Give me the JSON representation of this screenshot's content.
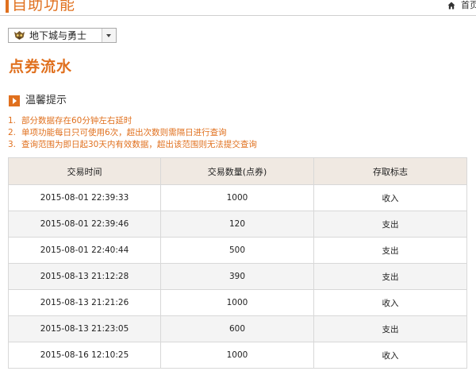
{
  "header": {
    "title": "自助功能",
    "home_label": "首页",
    "accent": "#e0701e"
  },
  "game_select": {
    "value": "地下城与勇士",
    "icon": "game-logo-icon"
  },
  "page": {
    "title": "点券流水"
  },
  "tips": {
    "title": "温馨提示",
    "items": [
      {
        "num": "1.",
        "text": "部分数据存在60分钟左右延时"
      },
      {
        "num": "2.",
        "text": "单项功能每日只可使用6次，超出次数则需隔日进行查询"
      },
      {
        "num": "3.",
        "text": "查询范围为即日起30天内有效数据，超出该范围则无法提交查询"
      }
    ]
  },
  "table": {
    "headers": [
      "交易时间",
      "交易数量(点券)",
      "存取标志"
    ],
    "rows": [
      [
        "2015-08-01 22:39:33",
        "1000",
        "收入"
      ],
      [
        "2015-08-01 22:39:46",
        "120",
        "支出"
      ],
      [
        "2015-08-01 22:40:44",
        "500",
        "支出"
      ],
      [
        "2015-08-13 21:12:28",
        "390",
        "支出"
      ],
      [
        "2015-08-13 21:21:26",
        "1000",
        "收入"
      ],
      [
        "2015-08-13 21:23:05",
        "600",
        "支出"
      ],
      [
        "2015-08-16 12:10:25",
        "1000",
        "收入"
      ]
    ]
  }
}
